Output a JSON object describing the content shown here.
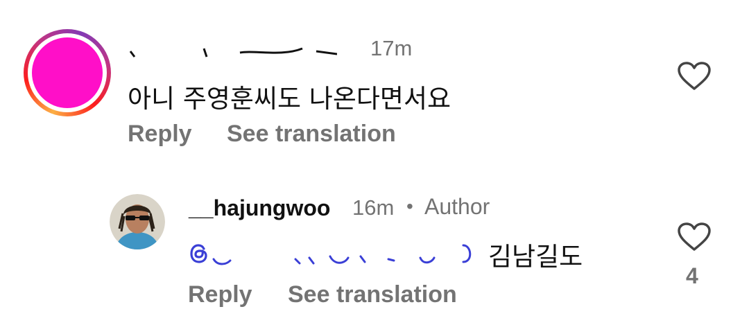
{
  "comments": [
    {
      "time": "17m",
      "text": "아니 주영훈씨도 나온다면서요",
      "reply_label": "Reply",
      "translate_label": "See translation"
    },
    {
      "username": "__hajungwoo",
      "time": "16m",
      "separator": "•",
      "badge": "Author",
      "text": "김남길도",
      "reply_label": "Reply",
      "translate_label": "See translation",
      "like_count": "4"
    }
  ],
  "icons": {
    "like": "heart-outline-icon",
    "mention": "threads-icon"
  },
  "colors": {
    "secondary_text": "#737373",
    "primary_text": "#111111",
    "mention_blue": "#3a3fd6",
    "avatar_fill": "#ff0fc8"
  }
}
